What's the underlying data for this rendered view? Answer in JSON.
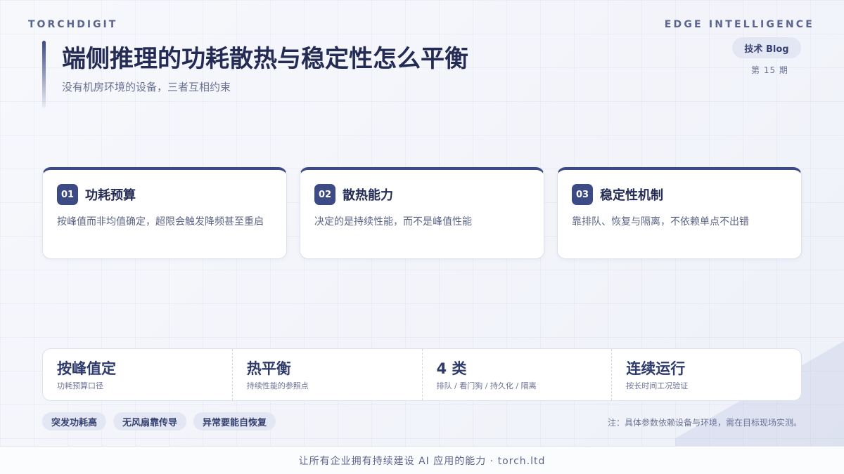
{
  "header": {
    "brand": "TORCHDIGIT",
    "edge": "EDGE INTELLIGENCE",
    "tag": "技术 Blog",
    "issue": "第 15 期"
  },
  "hero": {
    "title": "端侧推理的功耗散热与稳定性怎么平衡",
    "subtitle": "没有机房环境的设备，三者互相约束"
  },
  "cards": [
    {
      "num": "01",
      "title": "功耗预算",
      "desc": "按峰值而非均值确定，超限会触发降频甚至重启"
    },
    {
      "num": "02",
      "title": "散热能力",
      "desc": "决定的是持续性能，而不是峰值性能"
    },
    {
      "num": "03",
      "title": "稳定性机制",
      "desc": "靠排队、恢复与隔离，不依赖单点不出错"
    }
  ],
  "stats": [
    {
      "value": "按峰值定",
      "label": "功耗预算口径"
    },
    {
      "value": "热平衡",
      "label": "持续性能的参照点"
    },
    {
      "value": "4 类",
      "label": "排队 / 看门狗 / 持久化 / 隔离"
    },
    {
      "value": "连续运行",
      "label": "按长时间工况验证"
    }
  ],
  "chips": [
    "突发功耗高",
    "无风扇靠传导",
    "异常要能自恢复"
  ],
  "note": "注：具体参数依赖设备与环境，需在目标现场实测。",
  "footer": "让所有企业拥有持续建设 AI 应用的能力 · torch.ltd",
  "colors": {
    "accent": "#3c4a85",
    "title": "#242c55",
    "chip_bg": "#e3e7f4"
  }
}
